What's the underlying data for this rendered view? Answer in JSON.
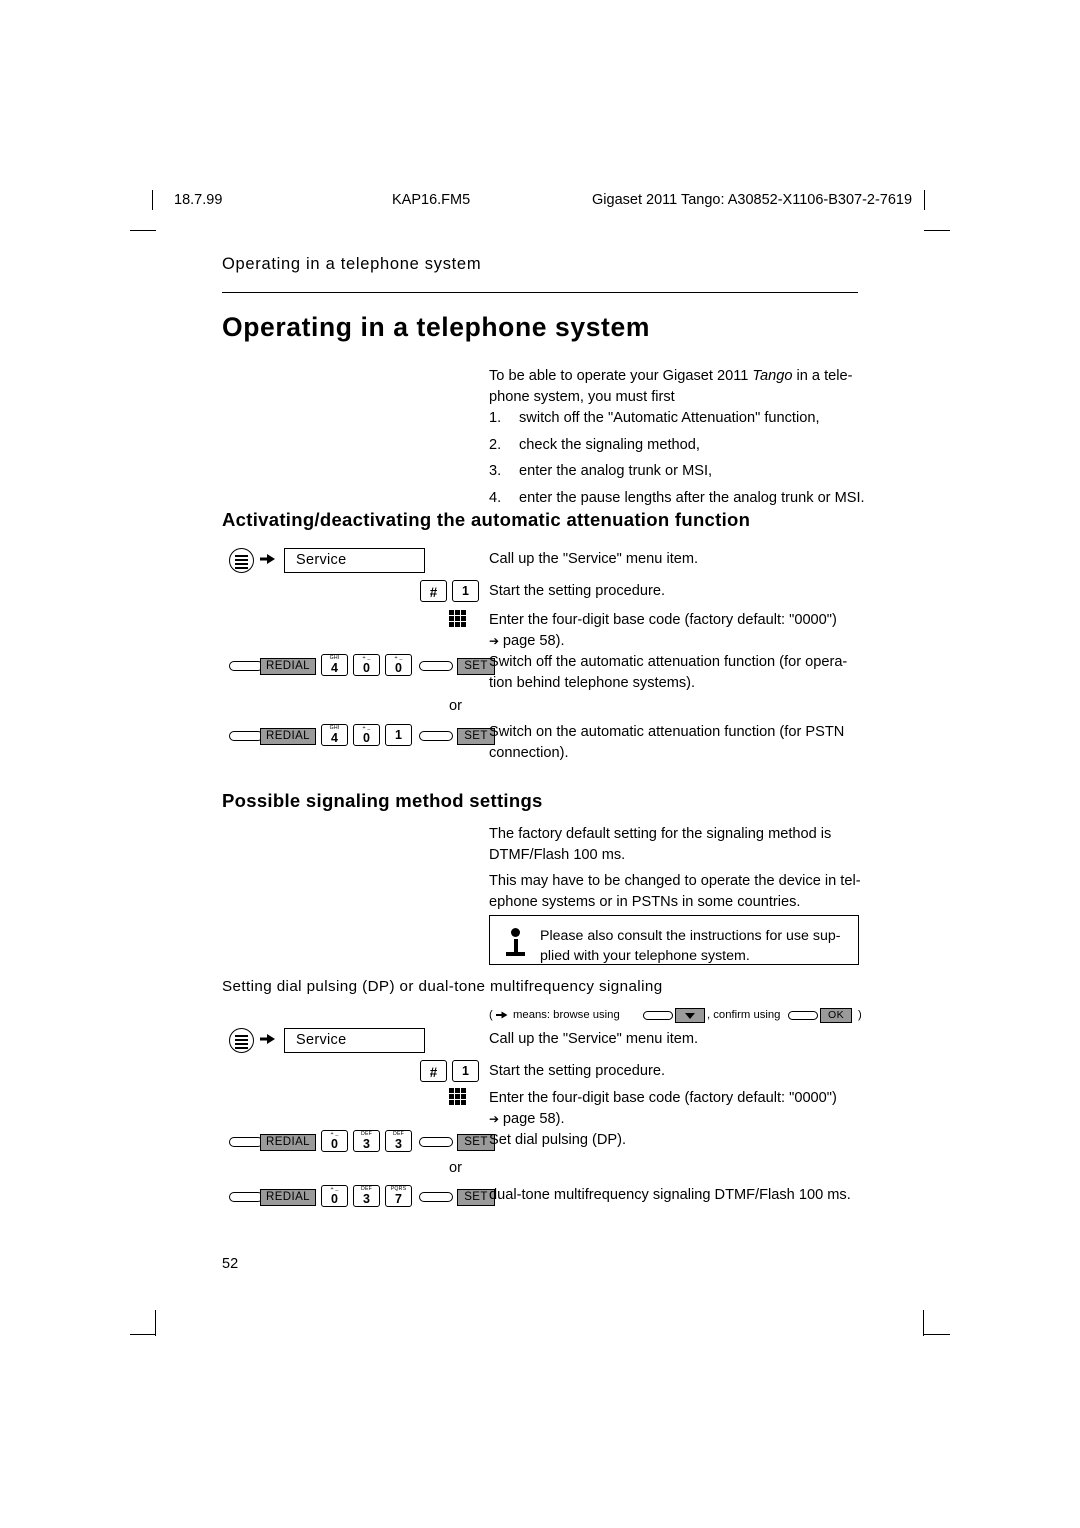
{
  "header": {
    "date": "18.7.99",
    "file": "KAP16.FM5",
    "doc": "Gigaset 2011 Tango: A30852-X1106-B307-2-7619"
  },
  "running_head": "Operating in a telephone system",
  "title": "Operating in a telephone system",
  "intro": {
    "line1": "To be able to operate your Gigaset 2011 ",
    "italic": "Tango",
    "line2": " in a tele-",
    "line3": "phone system, you must first"
  },
  "steps": [
    {
      "n": "1.",
      "text": "switch off the \"Automatic Attenuation\" function,"
    },
    {
      "n": "2.",
      "text": "check the signaling method,"
    },
    {
      "n": "3.",
      "text": "enter the analog trunk or MSI,"
    },
    {
      "n": "4.",
      "text": "enter the pause lengths after the analog trunk or MSI."
    }
  ],
  "section1": {
    "heading": "Activating/deactivating the automatic attenuation function",
    "row1": {
      "display": "Service",
      "text": "Call up the \"Service\" menu item."
    },
    "row2": {
      "key_hash": "#",
      "key_1_big": "1",
      "key_1_small": "",
      "text": "Start the setting procedure."
    },
    "row3": {
      "text1": "Enter the four-digit base code (factory default: \"0000\")",
      "text2": "page 58)."
    },
    "row4": {
      "redial": "REDIAL",
      "set": "SET",
      "keys": [
        {
          "big": "4",
          "small": "GHI"
        },
        {
          "big": "0",
          "small": "+ _"
        },
        {
          "big": "0",
          "small": "+ _"
        }
      ],
      "text1": "Switch off the automatic attenuation function (for opera-",
      "text2": "tion behind telephone systems)."
    },
    "or": "or",
    "row5": {
      "redial": "REDIAL",
      "set": "SET",
      "keys": [
        {
          "big": "4",
          "small": "GHI"
        },
        {
          "big": "0",
          "small": "+ _"
        },
        {
          "big": "1",
          "small": ""
        }
      ],
      "text1": "Switch on the automatic attenuation function (for PSTN",
      "text2": "connection)."
    }
  },
  "section2": {
    "heading": "Possible signaling method settings",
    "para1_l1": "The factory default setting for the signaling method is",
    "para1_l2": "DTMF/Flash 100 ms.",
    "para2_l1": "This may have to be changed to operate the device in tel-",
    "para2_l2": "ephone systems or in PSTNs in some countries.",
    "note_l1": "Please also consult the instructions for use sup-",
    "note_l2": "plied with your telephone system.",
    "subheading": "Setting dial pulsing (DP) or dual-tone multifrequency signaling",
    "legend": {
      "open": "(",
      "means": "means: browse using",
      "confirm": ", confirm using",
      "ok": "OK",
      "close": ")"
    },
    "row1": {
      "display": "Service",
      "text": "Call up the \"Service\" menu item."
    },
    "row2": {
      "key_hash": "#",
      "key_1_big": "1",
      "text": "Start the setting procedure."
    },
    "row3": {
      "text1": "Enter the four-digit base code (factory default: \"0000\")",
      "text2": "page 58)."
    },
    "row4": {
      "redial": "REDIAL",
      "set": "SET",
      "keys": [
        {
          "big": "0",
          "small": "+ _"
        },
        {
          "big": "3",
          "small": "DEF"
        },
        {
          "big": "3",
          "small": "DEF"
        }
      ],
      "text": "Set dial pulsing (DP)."
    },
    "or": "or",
    "row5": {
      "redial": "REDIAL",
      "set": "SET",
      "keys": [
        {
          "big": "0",
          "small": "+ _"
        },
        {
          "big": "3",
          "small": "DEF"
        },
        {
          "big": "7",
          "small": "PQRS"
        }
      ],
      "text": "dual-tone multifrequency signaling DTMF/Flash 100 ms."
    }
  },
  "page_number": "52"
}
